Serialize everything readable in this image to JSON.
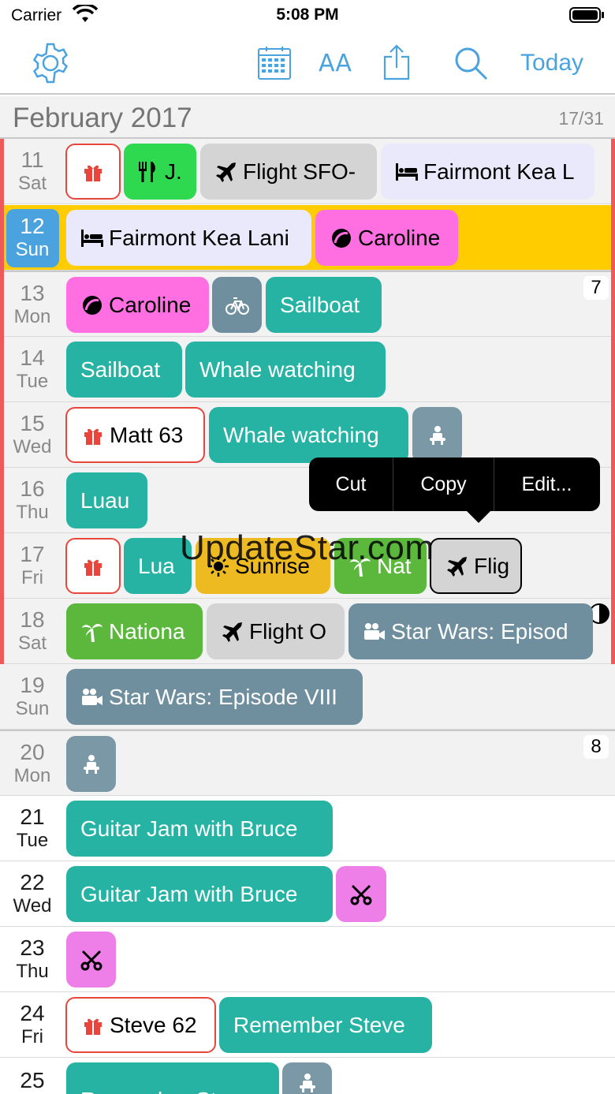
{
  "status_bar": {
    "carrier": "Carrier",
    "time": "5:08 PM"
  },
  "toolbar": {
    "font_button": "AA",
    "today_label": "Today"
  },
  "month": {
    "name": "February 2017",
    "count": "17/31"
  },
  "days": {
    "d11": {
      "num": "11",
      "name": "Sat",
      "ev1": "J.",
      "ev2": "Flight SFO-",
      "ev3": "Fairmont Kea L"
    },
    "d12": {
      "num": "12",
      "name": "Sun",
      "ev1": "Fairmont Kea Lani",
      "ev2": "Caroline"
    },
    "d13": {
      "num": "13",
      "name": "Mon",
      "week": "7",
      "ev1": "Caroline",
      "ev3": "Sailboat"
    },
    "d14": {
      "num": "14",
      "name": "Tue",
      "ev1": "Sailboat",
      "ev2": "Whale watching"
    },
    "d15": {
      "num": "15",
      "name": "Wed",
      "ev1": "Matt 63",
      "ev2": "Whale watching"
    },
    "d16": {
      "num": "16",
      "name": "Thu",
      "ev1": "Luau"
    },
    "d17": {
      "num": "17",
      "name": "Fri",
      "ev2": "Lua",
      "ev3": "Sunrise",
      "ev4": "Nat",
      "ev5": "Flig"
    },
    "d18": {
      "num": "18",
      "name": "Sat",
      "ev1": "Nationa",
      "ev2": "Flight O",
      "ev3": "Star Wars: Episod"
    },
    "d19": {
      "num": "19",
      "name": "Sun",
      "ev1": "Star Wars: Episode VIII"
    },
    "d20": {
      "num": "20",
      "name": "Mon",
      "week": "8"
    },
    "d21": {
      "num": "21",
      "name": "Tue",
      "ev1": "Guitar Jam with Bruce"
    },
    "d22": {
      "num": "22",
      "name": "Wed",
      "ev1": "Guitar Jam with Bruce"
    },
    "d23": {
      "num": "23",
      "name": "Thu"
    },
    "d24": {
      "num": "24",
      "name": "Fri",
      "ev1": "Steve 62",
      "ev2": "Remember Steve"
    },
    "d25": {
      "num": "25",
      "name": "",
      "ev1": "Remember Steve"
    }
  },
  "context_menu": {
    "cut": "Cut",
    "copy": "Copy",
    "edit": "Edit..."
  },
  "watermark": "UpdateStar.com",
  "icons": [
    "settings-gear",
    "calendar",
    "font-size",
    "share",
    "search",
    "gift",
    "restaurant",
    "airplane",
    "bed",
    "pokeball",
    "bicycle",
    "car-seat",
    "sun",
    "palm-tree",
    "movie-camera",
    "scissors",
    "half-moon"
  ],
  "colors": {
    "accent": "#4aa3df",
    "today": "#ffcc00",
    "teal_event": "#26b3a4",
    "pink_event": "#ff6fe1",
    "red_border": "#ec5a5a"
  }
}
